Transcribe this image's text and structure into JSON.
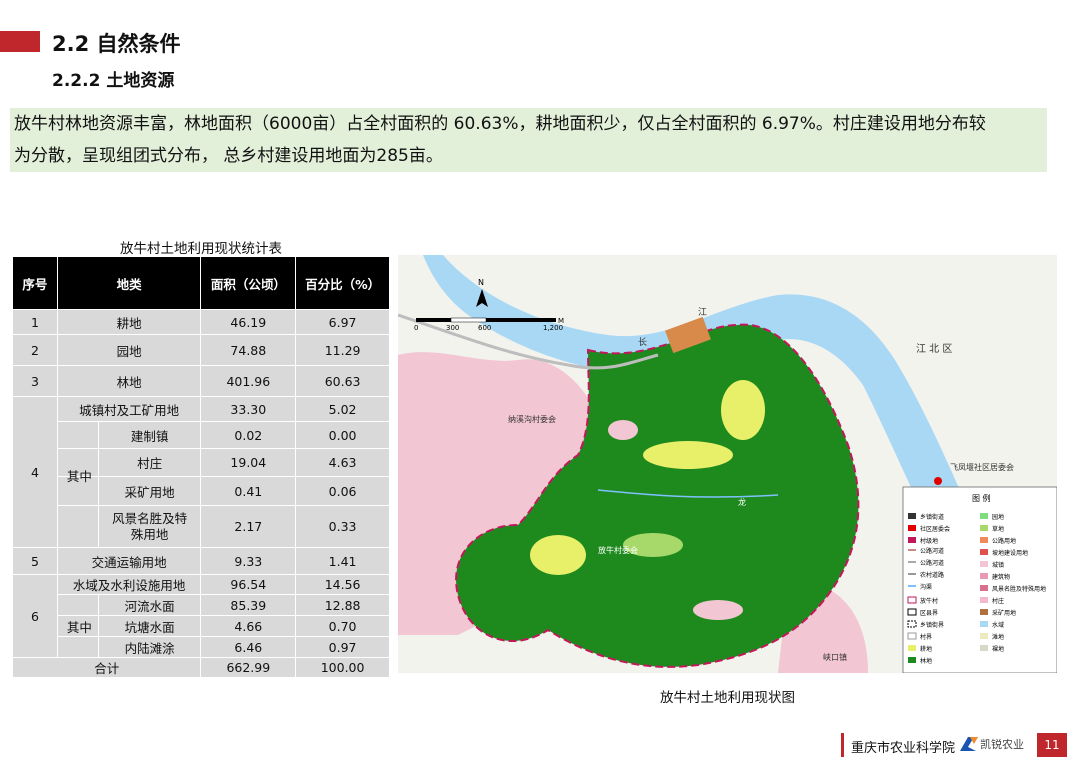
{
  "header": {
    "section_title": "2.2 自然条件",
    "subsection_title": "2.2.2 土地资源"
  },
  "intro": {
    "line1": "放牛村林地资源丰富，林地面积（6000亩）占全村面积的 60.63%，耕地面积少，仅占全村面积的 6.97%。村庄建设用地分布较",
    "line2": "为分散，呈现组团式分布， 总乡村建设用地面为285亩。"
  },
  "table": {
    "title": "放牛村土地利用现状统计表",
    "headers": [
      "序号",
      "地类",
      "面积（公顷）",
      "百分比（%）"
    ],
    "rows": {
      "r1": {
        "no": "1",
        "type": "耕地",
        "area": "46.19",
        "pct": "6.97"
      },
      "r2": {
        "no": "2",
        "type": "园地",
        "area": "74.88",
        "pct": "11.29"
      },
      "r3": {
        "no": "3",
        "type": "林地",
        "area": "401.96",
        "pct": "60.63"
      },
      "r4": {
        "no": "4",
        "type": "城镇村及工矿用地",
        "area": "33.30",
        "pct": "5.02",
        "sub_label": "其中",
        "subs": [
          {
            "type": "建制镇",
            "area": "0.02",
            "pct": "0.00"
          },
          {
            "type": "村庄",
            "area": "19.04",
            "pct": "4.63"
          },
          {
            "type": "采矿用地",
            "area": "0.41",
            "pct": "0.06"
          },
          {
            "type": "风景名胜及特殊用地",
            "area": "2.17",
            "pct": "0.33"
          }
        ]
      },
      "r5": {
        "no": "5",
        "type": "交通运输用地",
        "area": "9.33",
        "pct": "1.41"
      },
      "r6": {
        "no": "6",
        "type": "水域及水利设施用地",
        "area": "96.54",
        "pct": "14.56",
        "sub_label": "其中",
        "subs": [
          {
            "type": "河流水面",
            "area": "85.39",
            "pct": "12.88"
          },
          {
            "type": "坑塘水面",
            "area": "4.66",
            "pct": "0.70"
          },
          {
            "type": "内陆滩涂",
            "area": "6.46",
            "pct": "0.97"
          }
        ]
      },
      "total": {
        "label": "合计",
        "area": "662.99",
        "pct": "100.00"
      }
    }
  },
  "map": {
    "caption": "放牛村土地利用现状图",
    "north": "N",
    "scale_unit": "M",
    "scale_ticks": [
      "0",
      "300",
      "600",
      "1,200"
    ],
    "labels": {
      "district": "江 北 区",
      "river1": "江",
      "river2": "长",
      "committee1": "纳溪沟村委会",
      "committee2": "放牛村委会",
      "community": "飞凤堰社区居委会",
      "stream": "龙",
      "town": "峡口镇"
    },
    "legend_title": "图 例",
    "legend_left": [
      "乡镇街道",
      "社区居委会",
      "村级地",
      "公路河道",
      "公路河道",
      "农村道路",
      "沟渠",
      "放牛村",
      "区县界",
      "乡镇街界",
      "村界",
      "耕地",
      "林地"
    ],
    "legend_right": [
      "园地",
      "草地",
      "公路用地",
      "坡地建设用地",
      "城镇",
      "建筑物",
      "风景名胜及特殊用地",
      "村庄",
      "采矿用地",
      "水域",
      "滩地",
      "裸地"
    ]
  },
  "footer": {
    "org": "重庆市农业科学院",
    "brand": "凯锐农业",
    "page": "11"
  },
  "colors": {
    "accent_red": "#c0272d",
    "intro_bg": "#e2efd9",
    "table_header": "#000000",
    "table_cell": "#d9d9d9",
    "forest": "#1e8a1e",
    "water": "#a9d8f5",
    "village": "#f5b8c8",
    "farmland": "#e8f06a"
  }
}
